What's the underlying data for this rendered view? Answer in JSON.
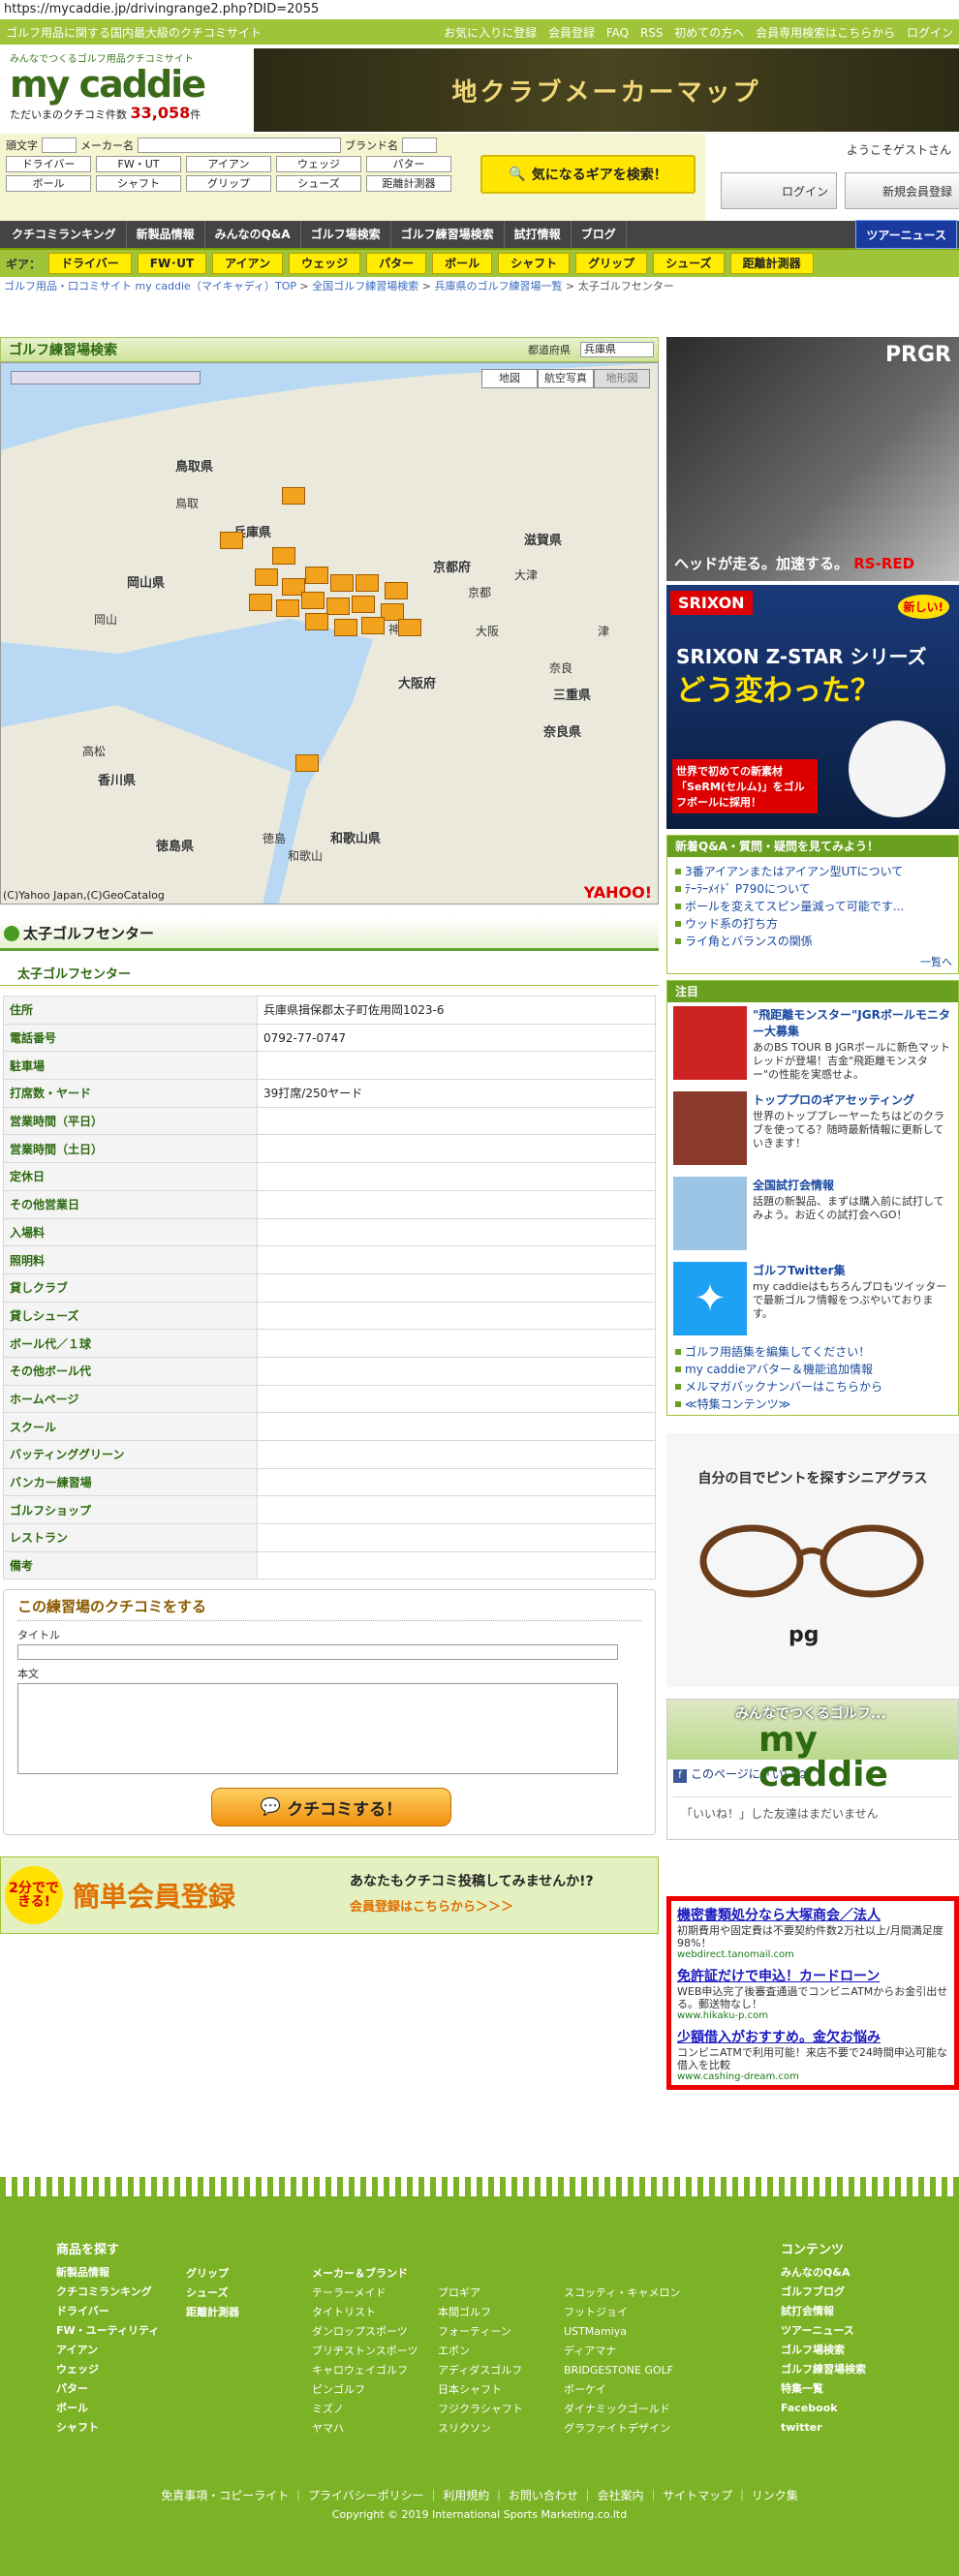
{
  "url": "https://mycaddie.jp/drivingrange2.php?DID=2055",
  "topbar": {
    "tagline": "ゴルフ用品に関する国内最大級のクチコミサイト",
    "links": [
      "お気に入りに登録",
      "会員登録",
      "FAQ",
      "RSS",
      "初めての方へ",
      "会員専用検索はこちらから",
      "ログイン"
    ]
  },
  "logo": {
    "tag": "みんなでつくるゴルフ用品クチコミサイト",
    "name": "my caddie",
    "count_label": "ただいまのクチコミ件数",
    "count": "33,058",
    "unit": "件"
  },
  "top_banner": "地クラブメーカーマップ",
  "search": {
    "l1": "頭文字",
    "l2": "メーカー名",
    "l3": "ブランド名",
    "row2": [
      "ドライバー",
      "FW・UT",
      "アイアン",
      "ウェッジ",
      "パター"
    ],
    "row3": [
      "ボール",
      "シャフト",
      "グリップ",
      "シューズ",
      "距離計測器"
    ],
    "button": "気になるギアを検索！"
  },
  "user": {
    "welcome": "ようこそゲストさん",
    "login": "ログイン",
    "register": "新規会員登録"
  },
  "gnav": [
    "クチコミランキング",
    "新製品情報",
    "みんなのQ&A",
    "ゴルフ場検索",
    "ゴルフ練習場検索",
    "試打情報",
    "ブログ",
    "ツアーニュース"
  ],
  "gear": {
    "label": "ギア：",
    "items": [
      "ドライバー",
      "FW･UT",
      "アイアン",
      "ウェッジ",
      "パター",
      "ボール",
      "シャフト",
      "グリップ",
      "シューズ",
      "距離計測器"
    ]
  },
  "breadcrumb": [
    "ゴルフ用品・口コミサイト my caddie（マイキャディ）TOP",
    "全国ゴルフ練習場検索",
    "兵庫県のゴルフ練習場一覧",
    "太子ゴルフセンター"
  ],
  "map": {
    "title": "ゴルフ練習場検索",
    "pref_label": "都道府県",
    "pref": "兵庫県",
    "types": [
      "地図",
      "航空写真",
      "地形図"
    ],
    "prefs": [
      "鳥取県",
      "兵庫県",
      "岡山県",
      "京都府",
      "滋賀県",
      "大阪府",
      "奈良県",
      "三重県",
      "香川県",
      "徳島県",
      "和歌山県"
    ],
    "cities": [
      "鳥取",
      "岡山",
      "京都",
      "神戸",
      "大阪",
      "津",
      "奈良",
      "高松",
      "徳島",
      "和歌山",
      "大津"
    ],
    "copyright": "(C)Yahoo Japan,(C)GeoCatalog",
    "logo": "YAHOO!"
  },
  "facility": {
    "name": "太子ゴルフセンター",
    "rows": [
      {
        "k": "住所",
        "v": "兵庫県揖保郡太子町佐用岡1023-6"
      },
      {
        "k": "電話番号",
        "v": "0792-77-0747"
      },
      {
        "k": "駐車場",
        "v": ""
      },
      {
        "k": "打席数・ヤード",
        "v": "39打席/250ヤード"
      },
      {
        "k": "営業時間（平日）",
        "v": ""
      },
      {
        "k": "営業時間（土日）",
        "v": ""
      },
      {
        "k": "定休日",
        "v": ""
      },
      {
        "k": "その他営業日",
        "v": ""
      },
      {
        "k": "入場料",
        "v": ""
      },
      {
        "k": "照明料",
        "v": ""
      },
      {
        "k": "貸しクラブ",
        "v": ""
      },
      {
        "k": "貸しシューズ",
        "v": ""
      },
      {
        "k": "ボール代／１球",
        "v": ""
      },
      {
        "k": "その他ボール代",
        "v": ""
      },
      {
        "k": "ホームページ",
        "v": ""
      },
      {
        "k": "スクール",
        "v": ""
      },
      {
        "k": "バッティンググリーン",
        "v": ""
      },
      {
        "k": "バンカー練習場",
        "v": ""
      },
      {
        "k": "ゴルフショップ",
        "v": ""
      },
      {
        "k": "レストラン",
        "v": ""
      },
      {
        "k": "備考",
        "v": ""
      }
    ]
  },
  "review": {
    "title": "この練習場のクチコミをする",
    "title_label": "タイトル",
    "body_label": "本文",
    "button": "クチコミする！"
  },
  "register": {
    "badge": "2分でできる!",
    "title": "簡単会員登録",
    "text": "あなたもクチコミ投稿してみませんか!?",
    "link": "会員登録はこちらから＞＞＞"
  },
  "side": {
    "ad1": {
      "brand": "PRGR",
      "copy": "ヘッドが走る。加速する。",
      "model": "RS-RED"
    },
    "ad2": {
      "brand": "SRIXON",
      "new": "新しい!",
      "t1": "SRIXON Z-STAR シリーズ",
      "t2": "どう変わった？",
      "t3": "世界で初めての新素材「SeRM(セルム)」をゴルフボールに採用！"
    },
    "qa": {
      "title": "新着Q&A・質問・疑問を見てみよう！",
      "items": [
        "3番アイアンまたはアイアン型UTについて",
        "ﾃｰﾗｰﾒｲﾄﾞ P790について",
        "ボールを変えてスピン量減って可能です...",
        "ウッド系の打ち方",
        "ライ角とバランスの関係"
      ],
      "more": "一覧へ"
    },
    "chumoku": {
      "title": "注目",
      "items": [
        {
          "t": "\"飛距離モンスター\"JGRボールモニター大募集",
          "d": "あのBS TOUR B JGRボールに新色マットレッドが登場！吉金\"飛距離モンスター\"の性能を実感せよ。"
        },
        {
          "t": "トッププロのギアセッティング",
          "d": "世界のトッププレーヤーたちはどのクラブを使ってる？随時最新情報に更新していきます！"
        },
        {
          "t": "全国試打会情報",
          "d": "話題の新製品、まずは購入前に試打してみよう。お近くの試打会へGO！"
        },
        {
          "t": "ゴルフTwitter集",
          "d": "my caddieはもちろんプロもツイッターで最新ゴルフ情報をつぶやいております。"
        }
      ],
      "links": [
        "ゴルフ用語集を編集してください！",
        "my caddieアバター＆機能追加情報",
        "メルマガバックナンバーはこちらから",
        "≪特集コンテンツ≫"
      ]
    },
    "ad3": {
      "t": "自分の目でピントを探すシニアグラス",
      "logo": "pg"
    },
    "fb": {
      "title": "みんなでつくるゴルフ...",
      "name": "my caddie",
      "like": "このページに「いいね！」",
      "none": "「いいね！」した友達はまだいません"
    },
    "ad4": [
      {
        "h": "機密書類処分なら大塚商会／法人",
        "d": "初期費用や固定費は不要契約件数2万社以上/月間満足度98%！",
        "u": "webdirect.tanomail.com"
      },
      {
        "h": "免許証だけで申込！カードローン",
        "d": "WEB申込完了後審査通過でコンビニATMからお金引出せる。郵送物なし！",
        "u": "www.hikaku-p.com"
      },
      {
        "h": "少額借入がおすすめ。金欠お悩み",
        "d": "コンビニATMで利用可能！来店不要で24時間申込可能な借入を比較",
        "u": "www.cashing-dream.com"
      }
    ]
  },
  "footer": {
    "goods_title": "商品を探す",
    "col1": [
      "新製品情報",
      "クチコミランキング",
      "ドライバー",
      "FW・ユーティリティ",
      "アイアン",
      "ウェッジ",
      "パター",
      "ボール",
      "シャフト"
    ],
    "col2": [
      "グリップ",
      "シューズ",
      "距離計測器"
    ],
    "maker_title": "メーカー＆ブランド",
    "makers": [
      "テーラーメイド",
      "プロギア",
      "スコッティ・キャメロン",
      "タイトリスト",
      "本間ゴルフ",
      "フットジョイ",
      "ダンロップスポーツ",
      "フォーティーン",
      "USTMamiya",
      "ブリヂストンスポーツ",
      "エポン",
      "ディアマナ",
      "キャロウェイゴルフ",
      "アディダスゴルフ",
      "BRIDGESTONE GOLF",
      "ピンゴルフ",
      "日本シャフト",
      "ボーケイ",
      "ミズノ",
      "フジクラシャフト",
      "ダイナミックゴールド",
      "ヤマハ",
      "スリクソン",
      "グラファイトデザイン"
    ],
    "contents_title": "コンテンツ",
    "contents": [
      "みんなのQ&A",
      "ゴルフブログ",
      "試打会情報",
      "ツアーニュース",
      "ゴルフ場検索",
      "ゴルフ練習場検索",
      "特集一覧",
      "Facebook",
      "twitter"
    ],
    "links": "免責事項・コピーライト ｜ プライバシーポリシー ｜ 利用規約 ｜ お問い合わせ ｜ 会社案内 ｜ サイトマップ ｜ リンク集",
    "copyright": "Copyright © 2019 International Sports Marketing.co.ltd"
  }
}
